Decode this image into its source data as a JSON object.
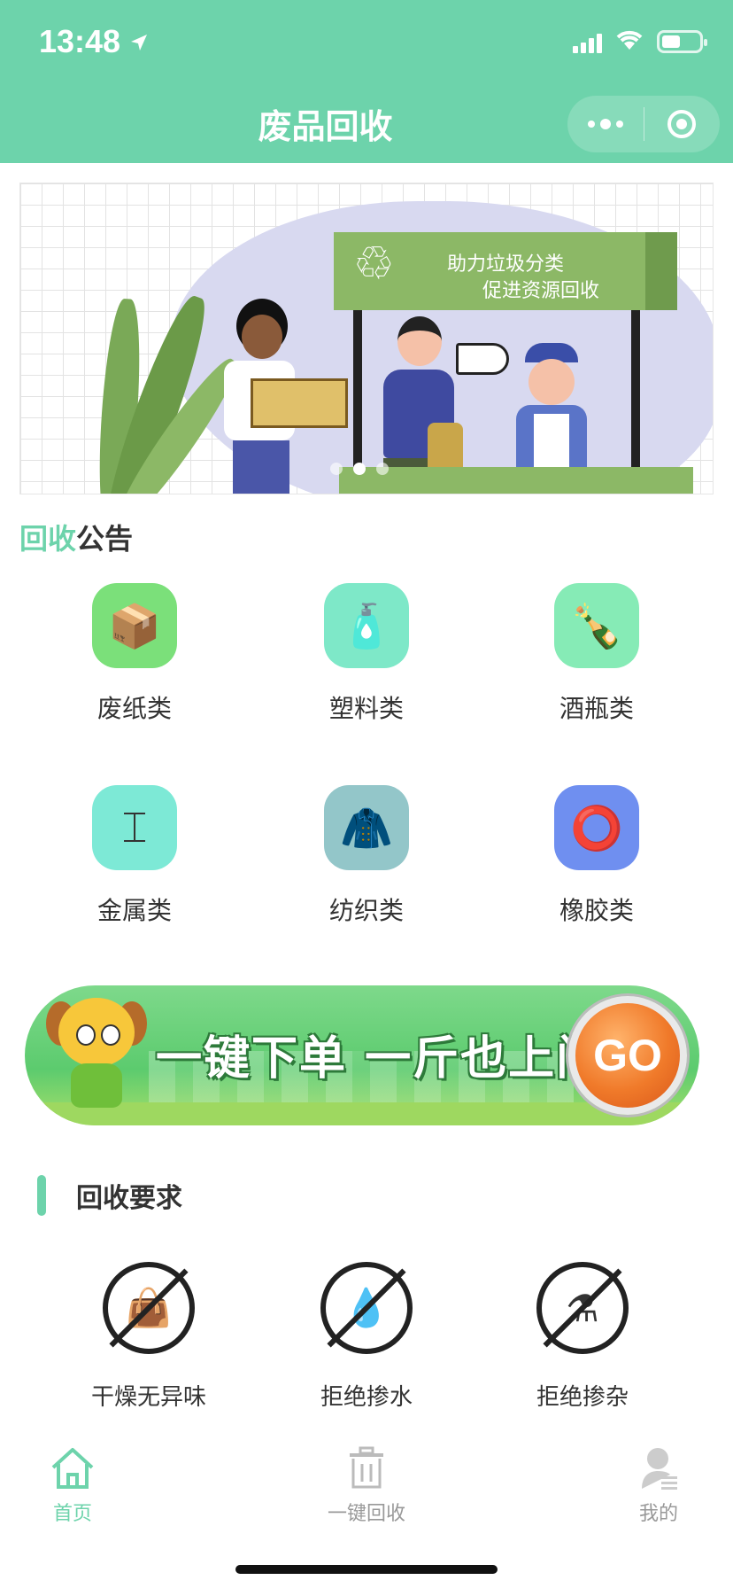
{
  "status_bar": {
    "time": "13:48"
  },
  "nav": {
    "title": "废品回收"
  },
  "banner": {
    "sign_line1": "助力垃圾分类",
    "sign_line2": "促进资源回收",
    "recycle_symbol": "♲"
  },
  "notice": {
    "highlight": "回收",
    "rest": "公告"
  },
  "categories": [
    {
      "label": "废纸类",
      "icon": "box-icon",
      "glyph": "📦",
      "color": "#7be07a"
    },
    {
      "label": "塑料类",
      "icon": "bottle-icon",
      "glyph": "🧴",
      "color": "#7ee8c8"
    },
    {
      "label": "酒瓶类",
      "icon": "wine-bottle-icon",
      "glyph": "🍾",
      "color": "#86ebb6"
    },
    {
      "label": "金属类",
      "icon": "steel-beam-icon",
      "glyph": "⌶",
      "color": "#7de9d6"
    },
    {
      "label": "纺织类",
      "icon": "jacket-icon",
      "glyph": "🧥",
      "color": "#93c6c9"
    },
    {
      "label": "橡胶类",
      "icon": "tire-icon",
      "glyph": "⭕",
      "color": "#6f8ff0"
    }
  ],
  "promo": {
    "slogan": "一键下单 一斤也上门",
    "go": "GO"
  },
  "requirements": {
    "title": "回收要求",
    "items": [
      {
        "label": "干燥无异味",
        "icon": "no-wet-bag-icon",
        "glyph": "👜"
      },
      {
        "label": "拒绝掺水",
        "icon": "no-water-icon",
        "glyph": "💧"
      },
      {
        "label": "拒绝掺杂",
        "icon": "no-impurity-icon",
        "glyph": "⚗"
      }
    ]
  },
  "tabbar": {
    "home": "首页",
    "recycle": "一键回收",
    "mine": "我的"
  },
  "colors": {
    "brand": "#6dd3ab",
    "inactive": "#999999"
  }
}
